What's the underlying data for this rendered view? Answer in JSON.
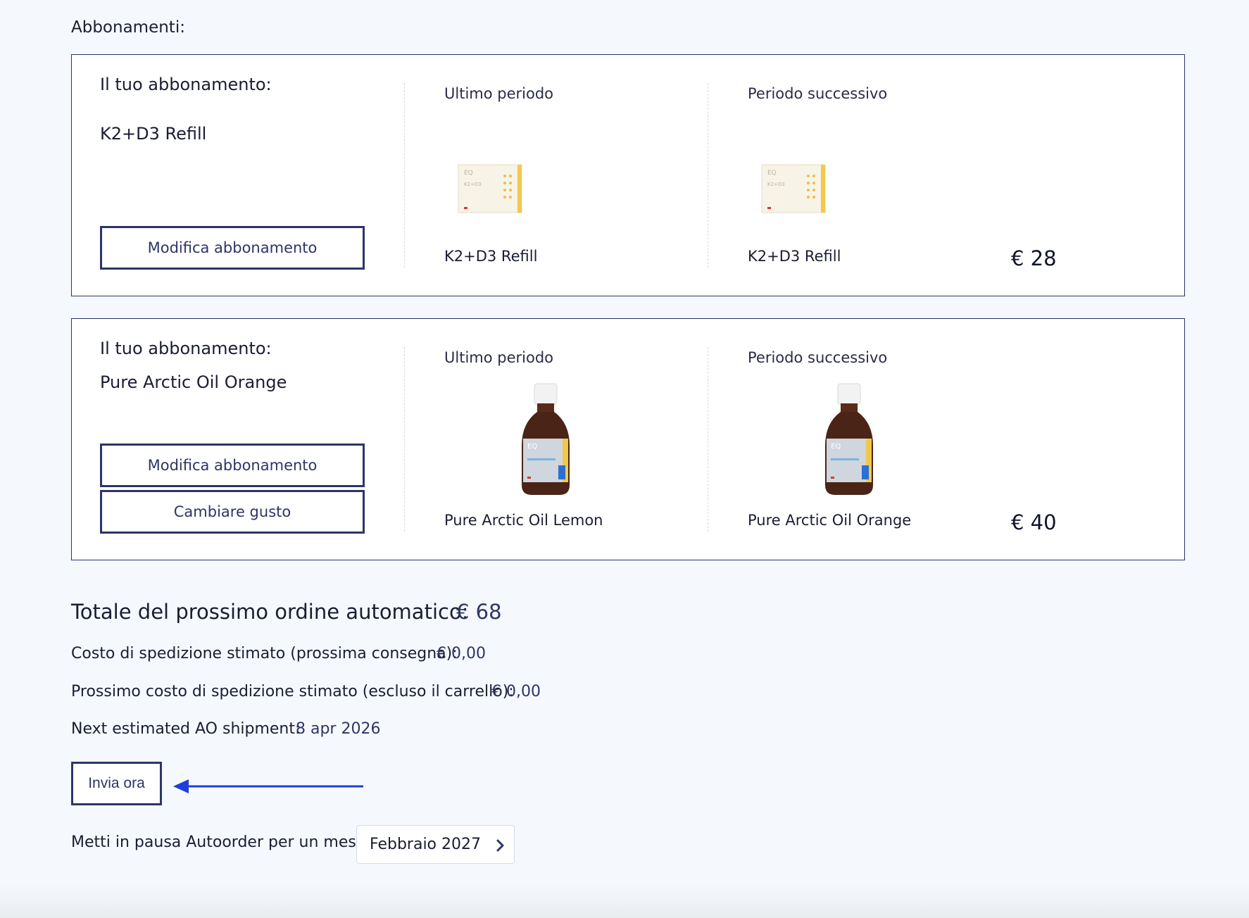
{
  "section_title": "Abbonamenti:",
  "subscriptions": [
    {
      "your_label": "Il tuo abbonamento:",
      "name": "K2+D3 Refill",
      "buttons": [
        "Modifica abbonamento"
      ],
      "last_period_label": "Ultimo periodo",
      "last_product": "K2+D3 Refill",
      "next_period_label": "Periodo successivo",
      "next_product": "K2+D3 Refill",
      "price": "€ 28"
    },
    {
      "your_label": "Il tuo abbonamento:",
      "name": "Pure Arctic Oil Orange",
      "buttons": [
        "Modifica abbonamento",
        "Cambiare gusto"
      ],
      "last_period_label": "Ultimo periodo",
      "last_product": "Pure Arctic Oil Lemon",
      "next_period_label": "Periodo successivo",
      "next_product": "Pure Arctic Oil Orange",
      "price": "€ 40"
    }
  ],
  "summary": {
    "total_label": "Totale del prossimo ordine automatico:",
    "total_value": "€ 68",
    "shipping_label": "Costo di spedizione stimato (prossima consegna):",
    "shipping_value": "€ 0,00",
    "next_shipping_label": "Prossimo costo di spedizione stimato (escluso il carrello):",
    "next_shipping_value": "€ 0,00",
    "next_shipment_label": "Next estimated AO shipment:",
    "next_shipment_value": "8 apr 2026"
  },
  "send_now_label": "Invia ora",
  "pause": {
    "label": "Metti in pausa Autoorder per un mese:",
    "selected_month": "Febbraio 2027"
  },
  "colors": {
    "accent": "#2e3566",
    "arrow": "#1f3fd8",
    "background": "#f5f9fd"
  },
  "icons": {
    "arrow": "arrow-left-icon",
    "select_chevron": "chevron-right-icon"
  }
}
